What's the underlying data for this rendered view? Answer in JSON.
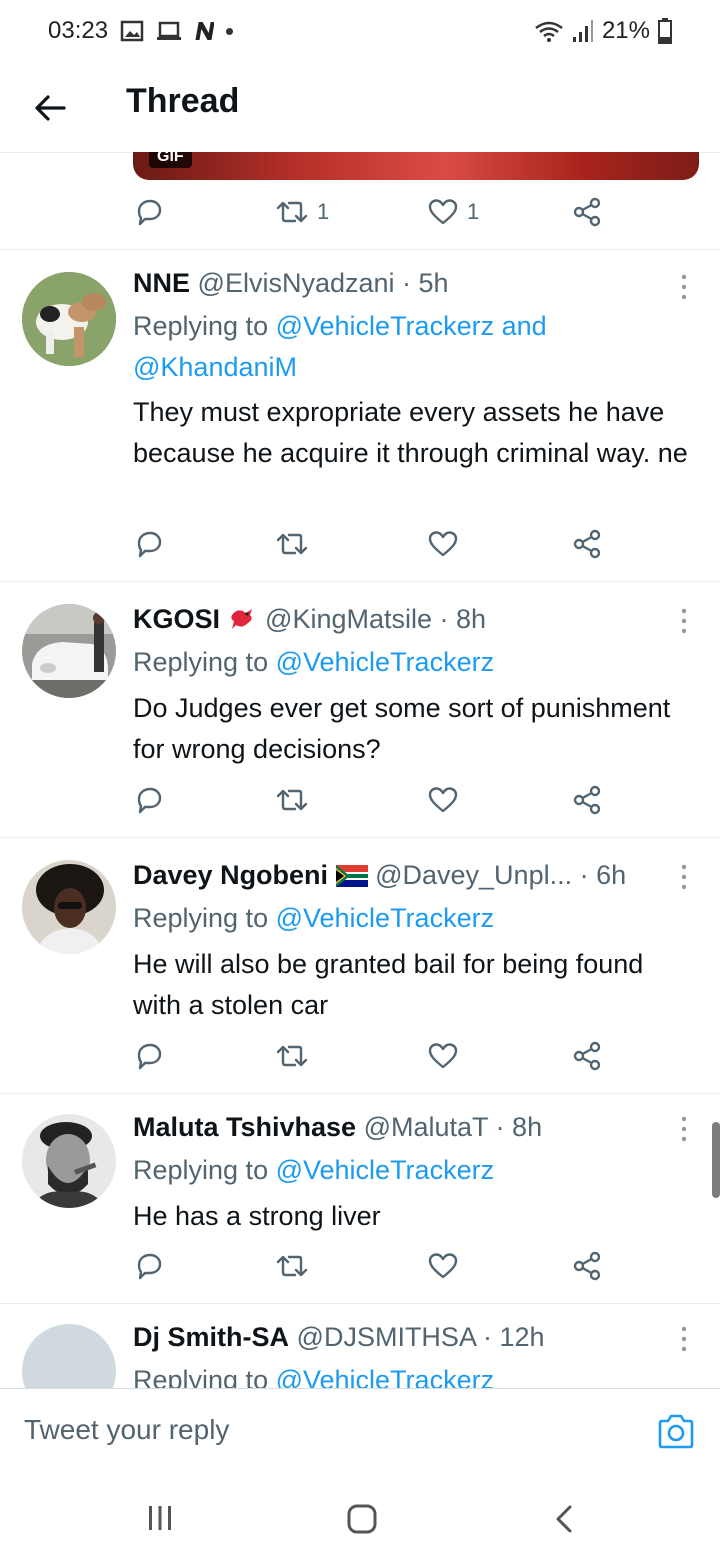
{
  "status_bar": {
    "time": "03:23",
    "battery": "21%"
  },
  "header": {
    "title": "Thread"
  },
  "top_tweet_actions": {
    "retweets": "1",
    "likes": "1",
    "media_tag": "GIF"
  },
  "tweets": [
    {
      "name": "NNE",
      "handle": "@ElvisNyadzani",
      "time": "· 5h",
      "replying_prefix": "Replying to ",
      "replying_to": "@VehicleTrackerz and @KhandaniM",
      "text": "They must expropriate every assets he have because he acquire it through criminal way. ne"
    },
    {
      "name": "KGOSI",
      "handle": "@KingMatsile",
      "time": "· 8h",
      "replying_prefix": "Replying to ",
      "replying_to": "@VehicleTrackerz",
      "text": "Do Judges ever get some sort of punishment for wrong decisions?"
    },
    {
      "name": "Davey Ngobeni",
      "handle": "@Davey_Unpl...",
      "time": "· 6h",
      "replying_prefix": "Replying to ",
      "replying_to": "@VehicleTrackerz",
      "text": "He will also be granted bail for being found with a stolen car"
    },
    {
      "name": "Maluta Tshivhase",
      "handle": "@MalutaT",
      "time": "· 8h",
      "replying_prefix": "Replying to ",
      "replying_to": "@VehicleTrackerz",
      "text": "He has a strong liver"
    },
    {
      "name": "Dj Smith-SA",
      "handle": "@DJSMITHSA",
      "time": "· 12h",
      "replying_prefix": "Replying to ",
      "replying_to": "@VehicleTrackerz",
      "text": ""
    }
  ],
  "reply_bar": {
    "placeholder": "Tweet your reply"
  },
  "colors": {
    "accent": "#1d9bf0",
    "muted": "#536471",
    "text": "#0f1419",
    "divider": "#e6ecf0"
  },
  "icons": [
    "back-arrow-icon",
    "reply-icon",
    "retweet-icon",
    "like-icon",
    "share-icon",
    "more-icon",
    "camera-icon",
    "recents-icon",
    "home-icon",
    "back-nav-icon"
  ]
}
